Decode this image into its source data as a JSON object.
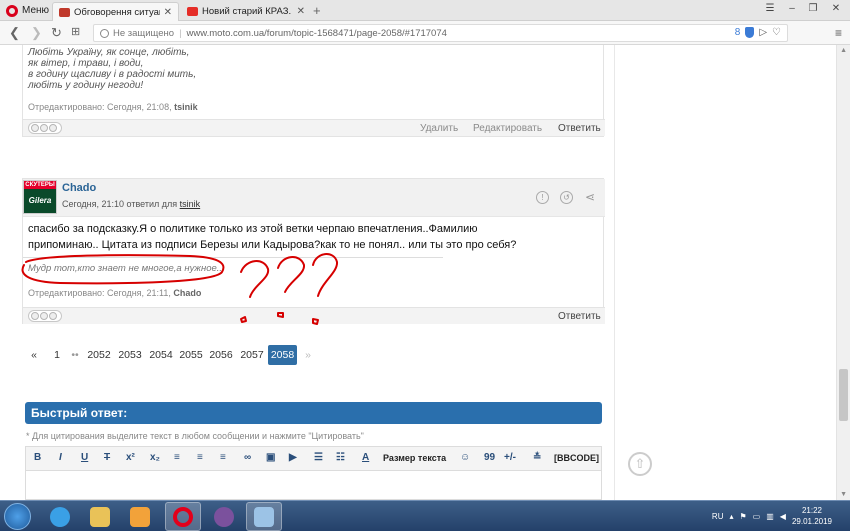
{
  "browser": {
    "menu_label": "Меню",
    "tabs": [
      {
        "title": "Обговорення ситуації в У"
      },
      {
        "title": "Новий старий КРАЗ. Исто"
      }
    ],
    "new_tab_symbol": "+",
    "address": {
      "security": "Не защищено",
      "url": "www.moto.com.ua/forum/topic-1568471/page-2058/#1717074",
      "badge_count": "8"
    }
  },
  "post1": {
    "poem_lines": [
      "Любіть Україну, як сонце, любіть,",
      "як вітер, і трави, і води,",
      "в годину щасливу і в радості мить,",
      "любіть у годину негоди!"
    ],
    "edited_prefix": "Отредактировано: Сегодня, 21:08,",
    "edited_user": "tsinik",
    "actions": {
      "delete": "Удалить",
      "edit": "Редактировать",
      "reply": "Ответить"
    }
  },
  "post2": {
    "avatar_top": "СКУТЕРЫ",
    "avatar_bottom": "Gilera",
    "username": "Chado",
    "meta_prefix": "Сегодня, 21:10 ответил для",
    "meta_user": "tsinik",
    "text_line1": "спасибо за подсказку.Я о политике только из этой ветки черпаю впечатления..Фамилию",
    "text_line2": "припоминаю.. Цитата из подписи Березы или Кадырова?как то не понял.. или ты это про себя?",
    "signature": "Мудр тот,кто знает не многое,а нужное...",
    "edited_prefix": "Отредактировано: Сегодня, 21:11,",
    "edited_user": "Chado",
    "reply": "Ответить"
  },
  "pagination": {
    "first": "«",
    "page1": "1",
    "ellipsis": "••",
    "pages": [
      "2052",
      "2053",
      "2054",
      "2055",
      "2056",
      "2057"
    ],
    "current": "2058",
    "next": "»"
  },
  "quick_reply": {
    "title": "Быстрый ответ:",
    "note": "* Для цитирования выделите текст в любом сообщении и нажмите \"Цитировать\"",
    "toolbar": {
      "bold": "B",
      "italic": "I",
      "underline": "U",
      "strike": "T",
      "sup": "x²",
      "sub": "x₂",
      "font_size": "Размер текста",
      "quote": "99",
      "plusminus": "+/-",
      "bbcode": "[BBCODE]"
    }
  },
  "taskbar": {
    "lang": "RU",
    "time": "21:22",
    "date": "29.01.2019"
  },
  "colors": {
    "accent": "#2a6fad",
    "link": "#2a6496",
    "annotation": "#d60000"
  }
}
